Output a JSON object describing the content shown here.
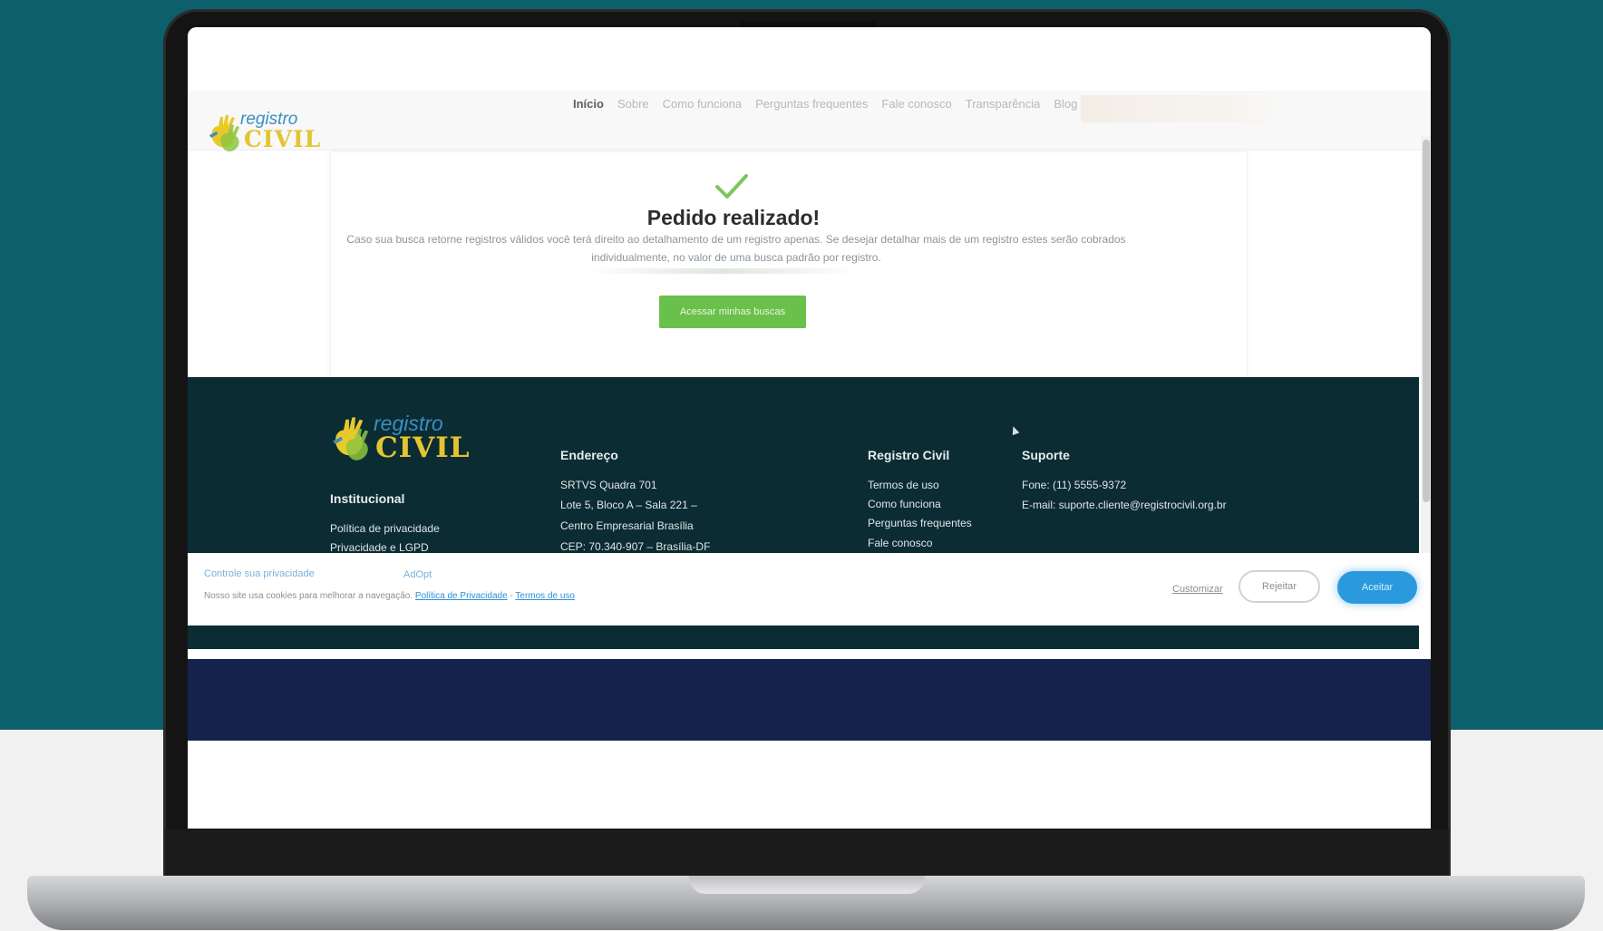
{
  "site": {
    "logo": {
      "word_small": "registro",
      "word_big": "CIVIL"
    },
    "nav": [
      {
        "label": "Início",
        "active": true
      },
      {
        "label": "Sobre"
      },
      {
        "label": "Como funciona"
      },
      {
        "label": "Perguntas frequentes"
      },
      {
        "label": "Fale conosco"
      },
      {
        "label": "Transparência"
      },
      {
        "label": "Blog"
      }
    ]
  },
  "confirmation": {
    "icon": "check-icon",
    "title": "Pedido realizado!",
    "description_line1": "Caso sua busca retorne registros válidos você terá direito ao detalhamento de um registro apenas. Se desejar detalhar mais de um registro estes serão cobrados",
    "description_line2": "individualmente, no valor de uma busca padrão por registro.",
    "button_label": "Acessar minhas buscas",
    "accent_color": "#69c04a"
  },
  "footer": {
    "institucional": {
      "heading": "Institucional",
      "items": [
        "Política de privacidade",
        "Privacidade e LGPD"
      ]
    },
    "endereco": {
      "heading": "Endereço",
      "lines": [
        "SRTVS Quadra 701",
        "Lote 5, Bloco A – Sala 221 –",
        "Centro Empresarial Brasília",
        "CEP: 70.340-907 – Brasília-DF"
      ]
    },
    "registro_civil": {
      "heading": "Registro Civil",
      "items": [
        "Termos de uso",
        "Como funciona",
        "Perguntas frequentes",
        "Fale conosco"
      ]
    },
    "suporte": {
      "heading": "Suporte",
      "phone": "Fone: (11) 5555-9372",
      "email": "E-mail: suporte.cliente@registrocivil.org.br"
    },
    "background_color": "#0c2c33"
  },
  "cookie_banner": {
    "title": "Controle sua privacidade",
    "brand": "AdOpt",
    "text": "Nosso site usa cookies para melhorar a navegação.",
    "privacy_link": "Política de Privacidade",
    "separator": "-",
    "terms_link": "Termos de uso",
    "customize_label": "Customizar",
    "reject_label": "Rejeitar",
    "accept_label": "Aceitar",
    "accept_color": "#2a99dd"
  }
}
